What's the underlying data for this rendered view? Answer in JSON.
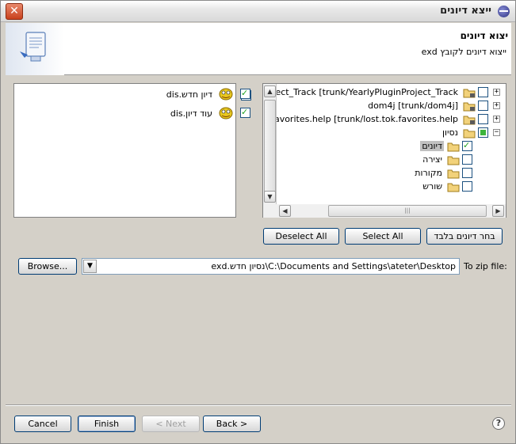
{
  "window": {
    "title": "ייצא דיונים"
  },
  "banner": {
    "title": "יצוא דיונים",
    "description": "ייצוא דיונים לקובץ exd"
  },
  "discussions": [
    {
      "label": "דיון חדש.dis",
      "checked": true
    },
    {
      "label": "עוד דיון.dis",
      "checked": true
    }
  ],
  "tree": [
    {
      "label": "YearlyPluginProject_Track [trunk/YearlyPluginProject_Track",
      "expander": "+",
      "checked": false,
      "indent": 0
    },
    {
      "label": "dom4j [trunk/dom4j]",
      "expander": "+",
      "checked": false,
      "indent": 0
    },
    {
      "label": "lost.tok.favorites.help [trunk/lost.tok.favorites.help",
      "expander": "+",
      "checked": false,
      "indent": 0
    },
    {
      "label": "נסיון",
      "expander": "−",
      "checked": "partial",
      "indent": 0
    },
    {
      "label": "דיונים",
      "expander": "",
      "checked": true,
      "indent": 1,
      "selected": true
    },
    {
      "label": "יצירה",
      "expander": "",
      "checked": false,
      "indent": 1
    },
    {
      "label": "מקורות",
      "expander": "",
      "checked": false,
      "indent": 1
    },
    {
      "label": "שורש",
      "expander": "",
      "checked": false,
      "indent": 1
    }
  ],
  "selection_buttons": {
    "deselect_all": "Deselect All",
    "select_all": "Select All",
    "select_discussions_only": "בחר דיונים בלבד"
  },
  "zip": {
    "label": "To zip file:",
    "value": "C:\\Documents and Settings\\ateter\\Desktop\\נסיון חדש.exd",
    "browse": "Browse..."
  },
  "footer": {
    "cancel": "Cancel",
    "finish": "Finish",
    "next": "< Next",
    "back": "Back >"
  },
  "colors": {
    "close_button": "#c8401c",
    "check_mark": "#21a121",
    "accent_border": "#003c74"
  }
}
